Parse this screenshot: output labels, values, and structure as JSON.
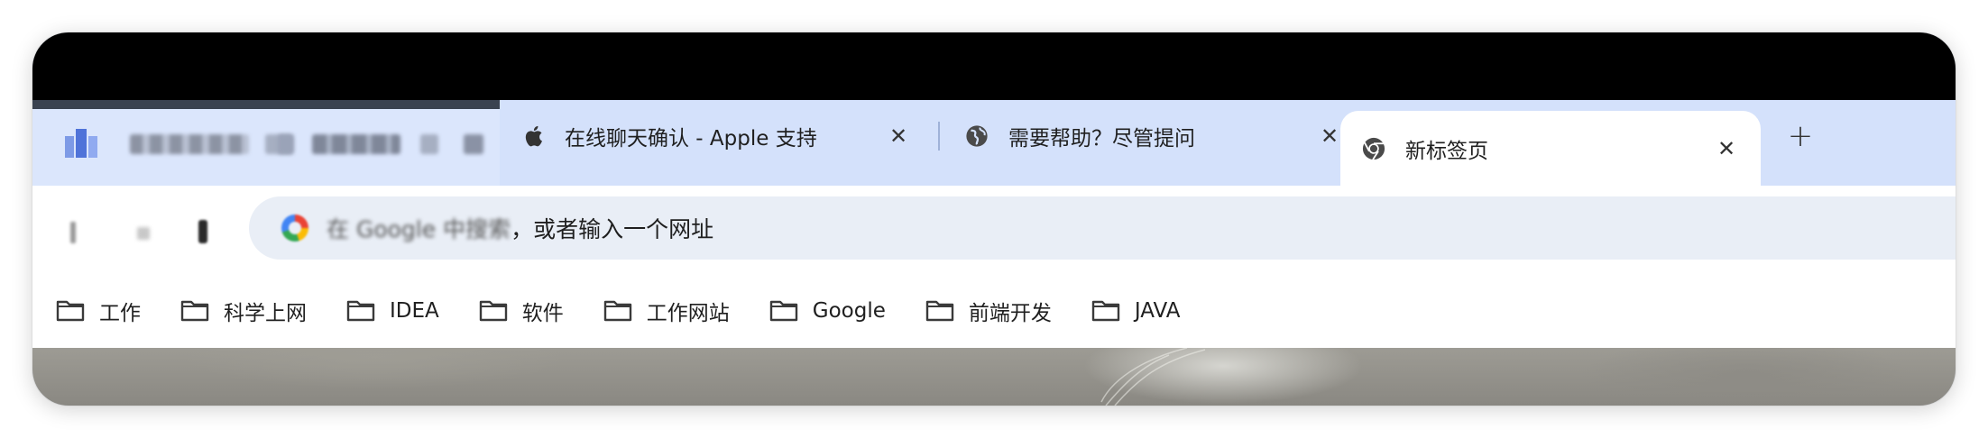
{
  "tabs": [
    {
      "title": "在线聊天确认 - Apple 支持",
      "favicon": "apple-logo-icon",
      "close": "✕"
    },
    {
      "title": "需要帮助？尽管提问",
      "favicon": "globe-icon",
      "close": "✕"
    },
    {
      "title": "新标签页",
      "favicon": "chrome-logo-icon",
      "close": "✕",
      "active": true
    }
  ],
  "new_tab_label": "+",
  "omnibox": {
    "placeholder_obscured": "在 Google 中搜索",
    "placeholder_visible": "，或者输入一个网址"
  },
  "bookmarks": [
    {
      "label": "工作"
    },
    {
      "label": "科学上网"
    },
    {
      "label": "IDEA"
    },
    {
      "label": "软件"
    },
    {
      "label": "工作网站"
    },
    {
      "label": "Google"
    },
    {
      "label": "前端开发"
    },
    {
      "label": "JAVA"
    }
  ],
  "colors": {
    "tab_strip": "#d4e1fb",
    "active_tab": "#ffffff",
    "omnibox_bg": "#e9eef6",
    "title_bar": "#000000"
  }
}
